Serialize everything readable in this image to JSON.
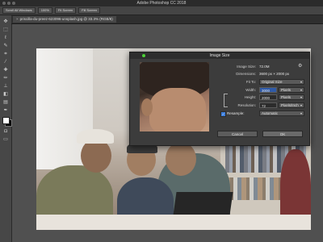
{
  "window": {
    "title": "Adobe Photoshop CC 2018"
  },
  "options_bar": {
    "items": [
      "Scroll All Windows",
      "100%",
      "Fit Screen",
      "Fill Screen"
    ]
  },
  "document_tab": {
    "label": "priscilla-du-preez-623096-unsplash.jpg @ 33.3% (RGB/8)"
  },
  "toolbar": {
    "tools": [
      "move-icon",
      "marquee-icon",
      "lasso-icon",
      "quick-select-icon",
      "crop-icon",
      "eyedropper-icon",
      "healing-icon",
      "brush-icon",
      "stamp-icon",
      "history-brush-icon",
      "eraser-icon",
      "gradient-icon",
      "blur-icon",
      "dodge-icon",
      "pen-icon",
      "type-icon",
      "path-select-icon",
      "shape-icon",
      "hand-icon",
      "zoom-icon"
    ]
  },
  "dialog": {
    "title": "Image Size",
    "image_size_label": "Image Size:",
    "image_size_value": "72.0M",
    "dimensions_label": "Dimensions:",
    "dimensions_value": "3600 px × 2000 px",
    "fit_to_label": "Fit To:",
    "fit_to_value": "Original Size",
    "width_label": "Width:",
    "width_value": "3000",
    "width_unit": "Pixels",
    "height_label": "Height:",
    "height_value": "2000",
    "height_unit": "Pixels",
    "resolution_label": "Resolution:",
    "resolution_value": "72",
    "resolution_unit": "Pixels/Inch",
    "resample_label": "Resample:",
    "resample_value": "Automatic",
    "resample_checked": true,
    "cancel_label": "Cancel",
    "ok_label": "OK"
  }
}
